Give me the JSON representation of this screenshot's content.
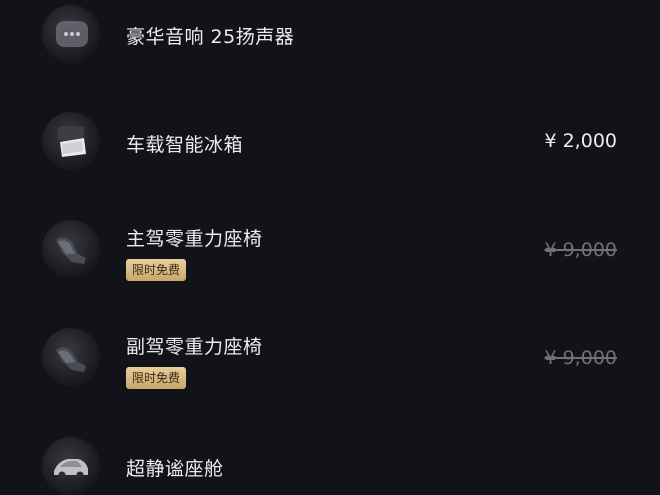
{
  "items": [
    {
      "name": "豪华音响 25扬声器",
      "price": "",
      "price_struck": false,
      "badge": "",
      "thumb_icon": "speaker-seat-photo-icon"
    },
    {
      "name": "车载智能冰箱",
      "price": "¥ 2,000",
      "price_struck": false,
      "badge": "",
      "thumb_icon": "fridge-photo-icon"
    },
    {
      "name": "主驾零重力座椅",
      "price": "¥ 9,000",
      "price_struck": true,
      "badge": "限时免费",
      "thumb_icon": "driver-seat-photo-icon"
    },
    {
      "name": "副驾零重力座椅",
      "price": "¥ 9,000",
      "price_struck": true,
      "badge": "限时免费",
      "thumb_icon": "passenger-seat-photo-icon"
    },
    {
      "name": "超静谧座舱",
      "price": "",
      "price_struck": false,
      "badge": "",
      "thumb_icon": "quiet-cabin-car-photo-icon"
    }
  ],
  "colors": {
    "background": "#121318",
    "text": "#ececf0",
    "struck_price": "#6f7078",
    "badge_gold": "#d9bb82",
    "badge_text": "#3a2a12"
  }
}
